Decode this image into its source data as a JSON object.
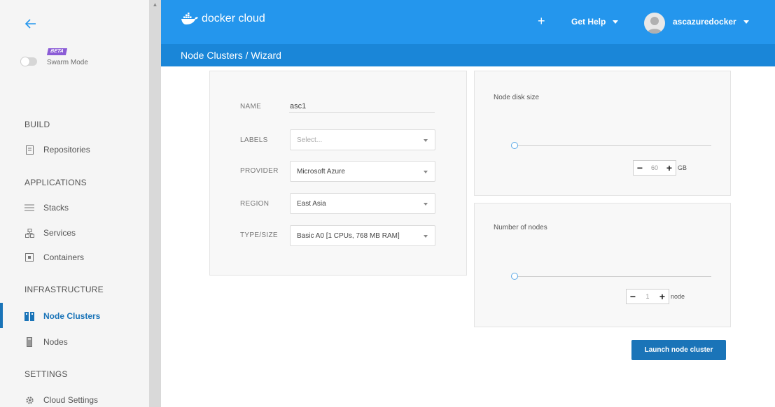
{
  "sidebar": {
    "swarm_badge": "BETA",
    "swarm_label": "Swarm Mode",
    "sections": {
      "build": "BUILD",
      "applications": "APPLICATIONS",
      "infrastructure": "INFRASTRUCTURE",
      "settings": "SETTINGS"
    },
    "items": [
      {
        "label": "Repositories",
        "icon": "repository-icon"
      },
      {
        "label": "Stacks",
        "icon": "stacks-icon"
      },
      {
        "label": "Services",
        "icon": "services-icon"
      },
      {
        "label": "Containers",
        "icon": "containers-icon"
      },
      {
        "label": "Node Clusters",
        "icon": "node-clusters-icon",
        "active": true
      },
      {
        "label": "Nodes",
        "icon": "nodes-icon"
      },
      {
        "label": "Cloud Settings",
        "icon": "gear-icon"
      }
    ]
  },
  "header": {
    "brand": "docker cloud",
    "plus_label": "+",
    "help_label": "Get Help",
    "username": "ascazuredocker",
    "breadcrumb": "Node Clusters / Wizard"
  },
  "form": {
    "name_label": "NAME",
    "name_value": "asc1",
    "labels_label": "LABELS",
    "labels_placeholder": "Select...",
    "provider_label": "PROVIDER",
    "provider_value": "Microsoft Azure",
    "region_label": "REGION",
    "region_value": "East Asia",
    "type_label": "TYPE/SIZE",
    "type_value": "Basic A0 [1 CPUs, 768 MB RAM]"
  },
  "disk": {
    "title": "Node disk size",
    "value": "60",
    "unit": "GB",
    "minus": "−",
    "plus": "+"
  },
  "nodes": {
    "title": "Number of nodes",
    "value": "1",
    "unit": "node",
    "minus": "−",
    "plus": "+"
  },
  "launch_label": "Launch node cluster",
  "colors": {
    "topbar": "#2496ed",
    "subbar": "#1a86d8",
    "accent": "#1a74b8",
    "beta": "#8b5cd6"
  }
}
